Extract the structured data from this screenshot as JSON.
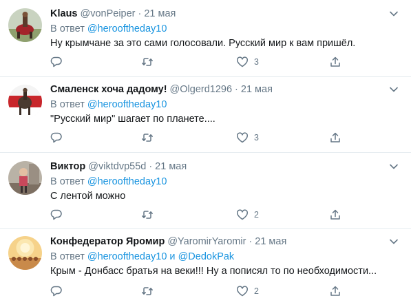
{
  "reply_prefix": "В ответ",
  "and_word": "и",
  "colors": {
    "link": "#1b95e0",
    "muted": "#657786",
    "text": "#14171a",
    "divider": "#e6ecf0"
  },
  "tweets": [
    {
      "name": "Klaus",
      "handle": "@vonPeiper",
      "time": "21 мая",
      "reply_to": [
        "@herooftheday10"
      ],
      "text": "Ну крымчане за это сами голосовали. Русский мир к вам пришёл.",
      "reply_count": "",
      "retweet_count": "",
      "like_count": "3"
    },
    {
      "name": "Смаленск хоча дадому!",
      "handle": "@Olgerd1296",
      "time": "21 мая",
      "reply_to": [
        "@herooftheday10"
      ],
      "text": "\"Русский мир\" шагает по планете....",
      "reply_count": "",
      "retweet_count": "",
      "like_count": "3"
    },
    {
      "name": "Виктор",
      "handle": "@viktdvp55d",
      "time": "21 мая",
      "reply_to": [
        "@herooftheday10"
      ],
      "text": "С лентой можно",
      "reply_count": "",
      "retweet_count": "",
      "like_count": "2"
    },
    {
      "name": "Конфедератор Яромир",
      "handle": "@YaromirYaromir",
      "time": "21 мая",
      "reply_to": [
        "@herooftheday10",
        "@DedokPak"
      ],
      "text": "Крым - Донбасс братья на веки!!! Ну а пописял то по необходимости...",
      "reply_count": "",
      "retweet_count": "",
      "like_count": "2"
    }
  ]
}
